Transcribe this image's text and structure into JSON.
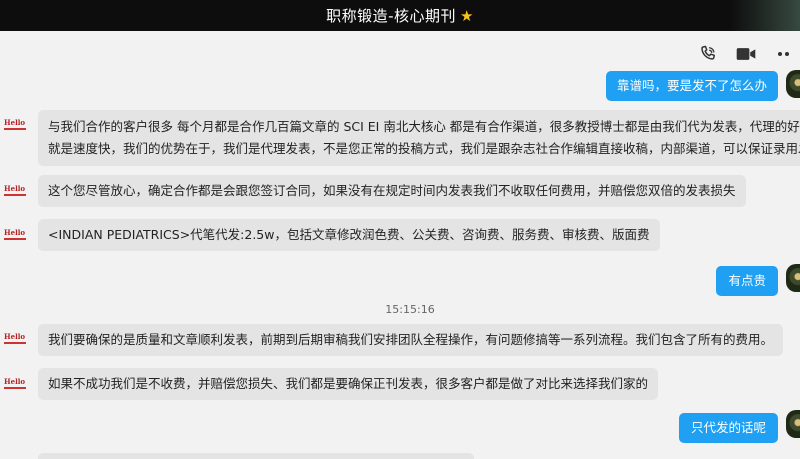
{
  "window": {
    "title": "职称锻造-核心期刊",
    "title_icon": "star-icon"
  },
  "toolbar": {
    "icons": [
      "phone-call-icon",
      "video-call-icon",
      "more-dots-icon"
    ]
  },
  "contact_avatar_text": "Hello",
  "timestamp": "15:15:16",
  "messages": [
    {
      "side": "right",
      "text": "靠谱吗，要是发不了怎么办"
    },
    {
      "side": "left",
      "lines": [
        "与我们合作的客户很多 每个月都是合作几百篇文章的   SCI EI  南北大核心 都是有合作渠道，很多教授博士都是由我们代为发表，代理的好处",
        "就是速度快，我们的优势在于，我们是代理发表，不是您正常的投稿方式，我们是跟杂志社合作编辑直接收稿，内部渠道，可以保证录用发表"
      ]
    },
    {
      "side": "left",
      "text": "这个您尽管放心，确定合作都是会跟您签订合同，如果没有在规定时间内发表我们不收取任何费用，并赔偿您双倍的发表损失"
    },
    {
      "side": "left",
      "text": "<INDIAN PEDIATRICS>代笔代发:2.5w，包括文章修改润色费、公关费、咨询费、服务费、审核费、版面费"
    },
    {
      "side": "right",
      "text": "有点贵"
    },
    {
      "side": "left",
      "text": "我们要确保的是质量和文章顺利发表，前期到后期审稿我们安排团队全程操作，有问题修搞等一系列流程。我们包含了所有的费用。"
    },
    {
      "side": "left",
      "text": "如果不成功我们是不收费，并赔偿您损失、我们都是要确保正刊发表，很多客户都是做了对比来选择我们家的"
    },
    {
      "side": "right",
      "text": "只代发的话呢"
    }
  ],
  "colors": {
    "titlebar_bg": "#0d0d0d",
    "outgoing_bubble": "#1fa0f2",
    "incoming_bubble": "#e4e4e4",
    "chat_bg": "#f2f2f2",
    "star": "#f6c21c"
  }
}
